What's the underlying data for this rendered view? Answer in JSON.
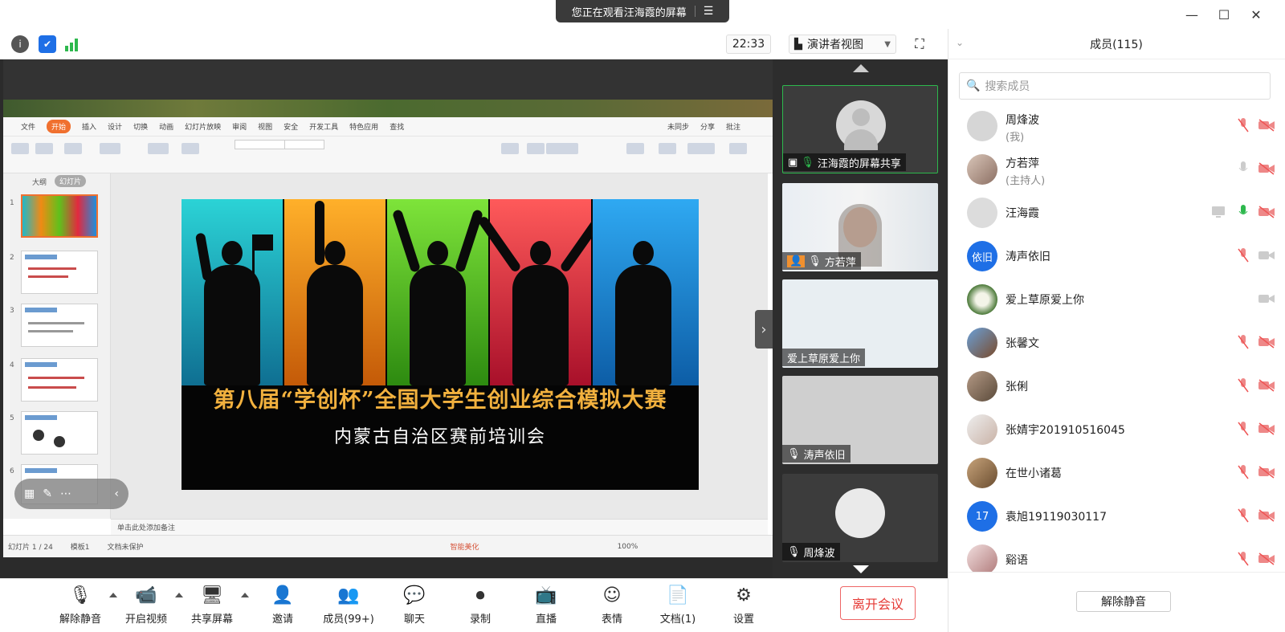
{
  "window": {
    "share_banner": "您正在观看汪海霞的屏幕",
    "banner_menu_icon": "list-icon",
    "controls": [
      "minimize-icon",
      "maximize-icon",
      "close-icon"
    ]
  },
  "status": {
    "time": "22:33",
    "view_mode": "演讲者视图",
    "icons": [
      "info-icon",
      "shield-icon",
      "signal-icon",
      "fullscreen-icon"
    ]
  },
  "presentation": {
    "menu": [
      "文件",
      "开始",
      "插入",
      "设计",
      "切换",
      "动画",
      "幻灯片放映",
      "审阅",
      "视图",
      "安全",
      "开发工具",
      "特色应用",
      "查找"
    ],
    "menu_active": "开始",
    "menu_right": [
      "未同步",
      "分享",
      "批注"
    ],
    "pane_tabs": [
      "大纲",
      "幻灯片"
    ],
    "thumb_numbers": [
      "1",
      "2",
      "3",
      "4",
      "5",
      "6"
    ],
    "slide_title": "第八届“学创杯”全国大学生创业综合模拟大赛",
    "slide_subtitle": "内蒙古自治区赛前培训会",
    "notes": "单击此处添加备注",
    "status_slide": "幻灯片 1 / 24",
    "status_theme": "模板1",
    "status_protect": "文档未保护",
    "status_beautify": "智能美化",
    "zoom": "100%",
    "strip_colors": [
      "#1fb8c9",
      "#f08a14",
      "#5fc11c",
      "#e2293f",
      "#1f8fdc"
    ]
  },
  "videos": [
    {
      "name": "汪海霞的屏幕共享",
      "type": "avatar"
    },
    {
      "name": "方若萍",
      "type": "camera"
    },
    {
      "name": "爱上草原爱上你",
      "type": "blank"
    },
    {
      "name": "涛声依旧",
      "type": "blank-gray"
    },
    {
      "name": "周烽波",
      "type": "avatar"
    }
  ],
  "toolbar": {
    "items": [
      {
        "label": "解除静音",
        "icon": "muted-mic-icon"
      },
      {
        "label": "开启视频",
        "icon": "video-off-icon"
      },
      {
        "label": "共享屏幕",
        "icon": "share-screen-icon"
      },
      {
        "label": "邀请",
        "icon": "invite-icon"
      },
      {
        "label": "成员(99+)",
        "icon": "members-icon"
      },
      {
        "label": "聊天",
        "icon": "chat-icon"
      },
      {
        "label": "录制",
        "icon": "record-icon"
      },
      {
        "label": "直播",
        "icon": "live-icon"
      },
      {
        "label": "表情",
        "icon": "emoji-icon"
      },
      {
        "label": "文档(1)",
        "icon": "document-icon"
      },
      {
        "label": "设置",
        "icon": "settings-icon"
      }
    ],
    "leave": "离开会议"
  },
  "members": {
    "title": "成员(115)",
    "search_placeholder": "搜索成员",
    "unmute_all": "解除静音",
    "list": [
      {
        "name": "周烽波",
        "role": "(我)",
        "avatar": "gray"
      },
      {
        "name": "方若萍",
        "role": "(主持人)",
        "avatar": "photo"
      },
      {
        "name": "汪海霞",
        "role": "",
        "avatar": "gray"
      },
      {
        "name": "涛声依旧",
        "role": "",
        "avatar": "text",
        "avatar_text": "依旧",
        "avatar_color": "#1e6fe6"
      },
      {
        "name": "爱上草原爱上你",
        "role": "",
        "avatar": "photo"
      },
      {
        "name": "张馨文",
        "role": "",
        "avatar": "photo"
      },
      {
        "name": "张俐",
        "role": "",
        "avatar": "photo"
      },
      {
        "name": "张婧宇201910516045",
        "role": "",
        "avatar": "photo"
      },
      {
        "name": "在世小诸葛",
        "role": "",
        "avatar": "photo"
      },
      {
        "name": "袁旭19119030117",
        "role": "",
        "avatar": "text",
        "avatar_text": "17",
        "avatar_color": "#1e6fe6"
      },
      {
        "name": "谿语",
        "role": "",
        "avatar": "photo"
      }
    ]
  }
}
